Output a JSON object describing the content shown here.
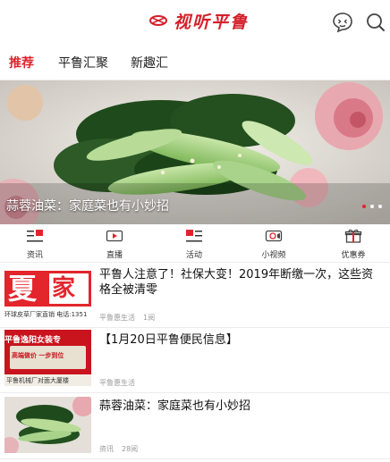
{
  "header": {
    "logo_text": "视听平鲁",
    "chat_icon": "chat-face-icon",
    "search_icon": "search-icon"
  },
  "tabs": [
    {
      "label": "推荐",
      "active": true
    },
    {
      "label": "平鲁汇聚",
      "active": false
    },
    {
      "label": "新趣汇",
      "active": false
    }
  ],
  "banner": {
    "caption": "蒜蓉油菜：家庭菜也有小妙招",
    "slides": 3,
    "active_slide": 1
  },
  "quicknav": [
    {
      "label": "资讯",
      "icon": "news-icon"
    },
    {
      "label": "直播",
      "icon": "live-play-icon"
    },
    {
      "label": "活动",
      "icon": "activity-icon"
    },
    {
      "label": "小视频",
      "icon": "video-camera-icon"
    },
    {
      "label": "优惠券",
      "icon": "gift-coupon-icon"
    }
  ],
  "news": [
    {
      "title": "平鲁人注意了！社保大变！2019年断缴一次，这些资格全被清零",
      "source": "平鲁惠生活",
      "reads": "1阅",
      "thumb_text_big": "夏",
      "thumb_text_big2": "家",
      "thumb_text_small": "环球皮草厂家直销 电话:1351"
    },
    {
      "title": "【1月20日平鲁便民信息】",
      "source": "平鲁惠生活",
      "reads": "",
      "thumb_text_top": "平鲁逸阳女装专",
      "thumb_text_mid": "高端做价 一步到位",
      "thumb_text_bottom": "平鲁机械厂对面大厦楼"
    },
    {
      "title": "蒜蓉油菜：家庭菜也有小妙招",
      "source": "资讯",
      "reads": "28阅"
    }
  ],
  "colors": {
    "brand_red": "#d4202b",
    "tab_active": "#e0242d",
    "meta_gray": "#999999"
  }
}
